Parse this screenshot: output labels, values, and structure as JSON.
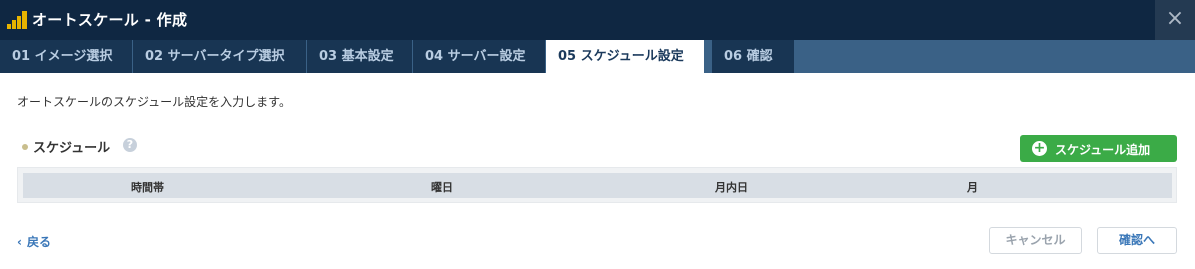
{
  "window": {
    "title": "オートスケール - 作成",
    "close_icon": "×"
  },
  "tabs": [
    {
      "label": "01 イメージ選択",
      "active": false
    },
    {
      "label": "02 サーバータイプ選択",
      "active": false
    },
    {
      "label": "03 基本設定",
      "active": false
    },
    {
      "label": "04 サーバー設定",
      "active": false
    },
    {
      "label": "05 スケジュール設定",
      "active": true
    },
    {
      "label": "06 確認",
      "active": false
    }
  ],
  "main": {
    "description": "オートスケールのスケジュール設定を入力します。",
    "section_title": "スケジュール",
    "help_icon": "?",
    "add_button_icon": "+",
    "add_button_label": "スケジュール追加",
    "table": {
      "columns": [
        "時間帯",
        "曜日",
        "月内日",
        "月"
      ],
      "rows": []
    }
  },
  "footer": {
    "back_icon": "‹",
    "back_label": "戻る",
    "cancel_label": "キャンセル",
    "confirm_label": "確認へ"
  },
  "colors": {
    "titlebar": "#0f2742",
    "tab_bg": "#183553",
    "tab_strip": "#3a6186",
    "accent_green": "#3bab47",
    "link_blue": "#3a77b8",
    "logo_yellow": "#e8b400"
  }
}
